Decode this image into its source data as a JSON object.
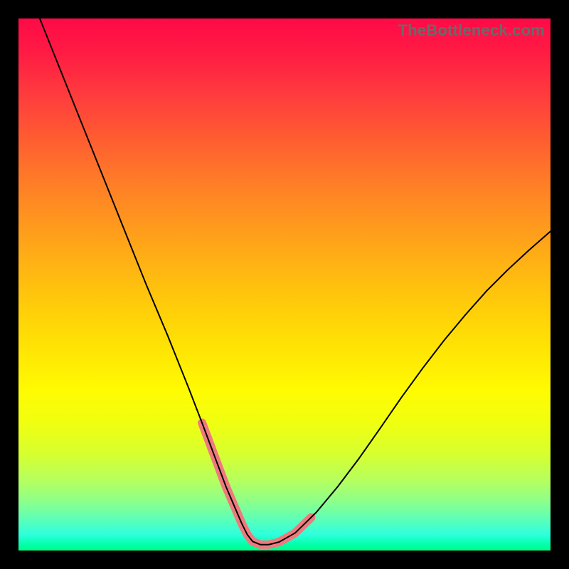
{
  "watermark": "TheBottleneck.com",
  "chart_data": {
    "type": "line",
    "title": "",
    "xlabel": "",
    "ylabel": "",
    "xlim": [
      0,
      100
    ],
    "ylim": [
      0,
      100
    ],
    "series": [
      {
        "name": "black-curve",
        "color": "#000000",
        "width": 2,
        "x": [
          4,
          8,
          12,
          16,
          20,
          24,
          28,
          32,
          34.5,
          36,
          37.5,
          39,
          40.5,
          42,
          43,
          44,
          45.5,
          47,
          49,
          52,
          56,
          60,
          64,
          68,
          72,
          76,
          80,
          84,
          88,
          92,
          96,
          100
        ],
        "y": [
          100,
          90,
          80,
          70,
          60,
          50,
          40.5,
          30.5,
          24,
          20,
          16,
          12,
          8.5,
          5,
          3,
          1.7,
          1.1,
          1.1,
          1.6,
          3.3,
          7.2,
          12,
          17.3,
          23,
          28.8,
          34.3,
          39.5,
          44.3,
          48.8,
          52.8,
          56.5,
          60
        ]
      },
      {
        "name": "pink-highlight",
        "color": "#ef7a7e",
        "width": 12,
        "x": [
          34.5,
          36,
          37.5,
          39,
          40.5,
          42,
          43,
          44,
          45.5,
          47,
          49,
          52,
          55
        ],
        "y": [
          24,
          20,
          16,
          12,
          8.5,
          5,
          3,
          1.7,
          1.1,
          1.1,
          1.6,
          3.3,
          6.2
        ]
      }
    ],
    "notes": "No axis ticks or numeric labels are visible in the source image; x and y are normalized 0–100 estimates read from the plot area proportions. The curve is a V-shaped bottleneck chart with minimum around x≈46. A thick pink stroke overlays the black curve near the bottom of the V."
  }
}
